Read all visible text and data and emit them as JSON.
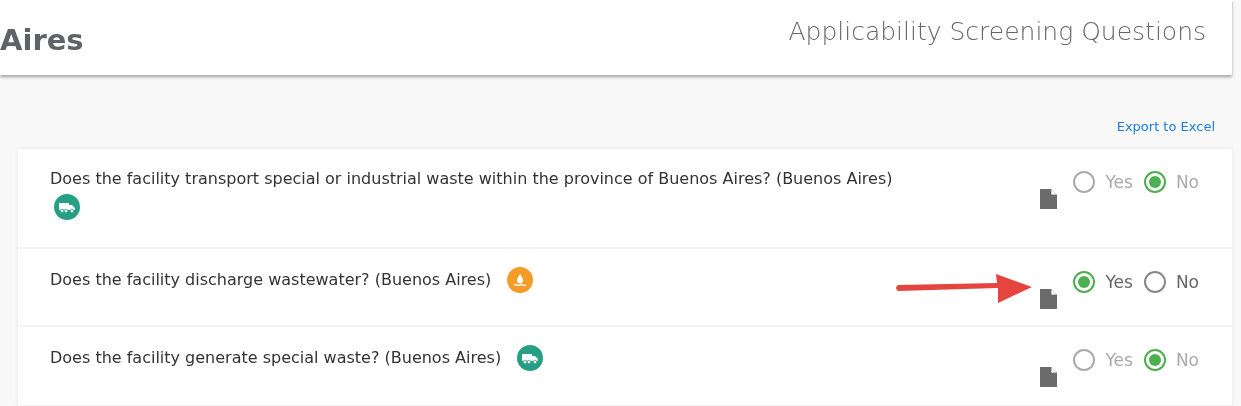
{
  "header": {
    "title": "Aires",
    "subtitle": "Applicability Screening Questions"
  },
  "export_link": "Export to Excel",
  "questions": [
    {
      "text": "Does the facility transport special or industrial waste within the province of Buenos Aires? (Buenos Aires)",
      "badge": {
        "kind": "truck",
        "color": "#26a085"
      },
      "disabled": true,
      "pointer_arrow": false,
      "options": [
        {
          "label": "Yes",
          "selected": false
        },
        {
          "label": "No",
          "selected": true
        }
      ]
    },
    {
      "text": "Does the facility discharge wastewater? (Buenos Aires)",
      "badge": {
        "kind": "water",
        "color": "#f59c27"
      },
      "disabled": false,
      "pointer_arrow": true,
      "options": [
        {
          "label": "Yes",
          "selected": true
        },
        {
          "label": "No",
          "selected": false
        }
      ]
    },
    {
      "text": "Does the facility generate special waste? (Buenos Aires)",
      "badge": {
        "kind": "truck",
        "color": "#26a085"
      },
      "disabled": true,
      "pointer_arrow": false,
      "options": [
        {
          "label": "Yes",
          "selected": false
        },
        {
          "label": "No",
          "selected": true
        }
      ]
    }
  ]
}
